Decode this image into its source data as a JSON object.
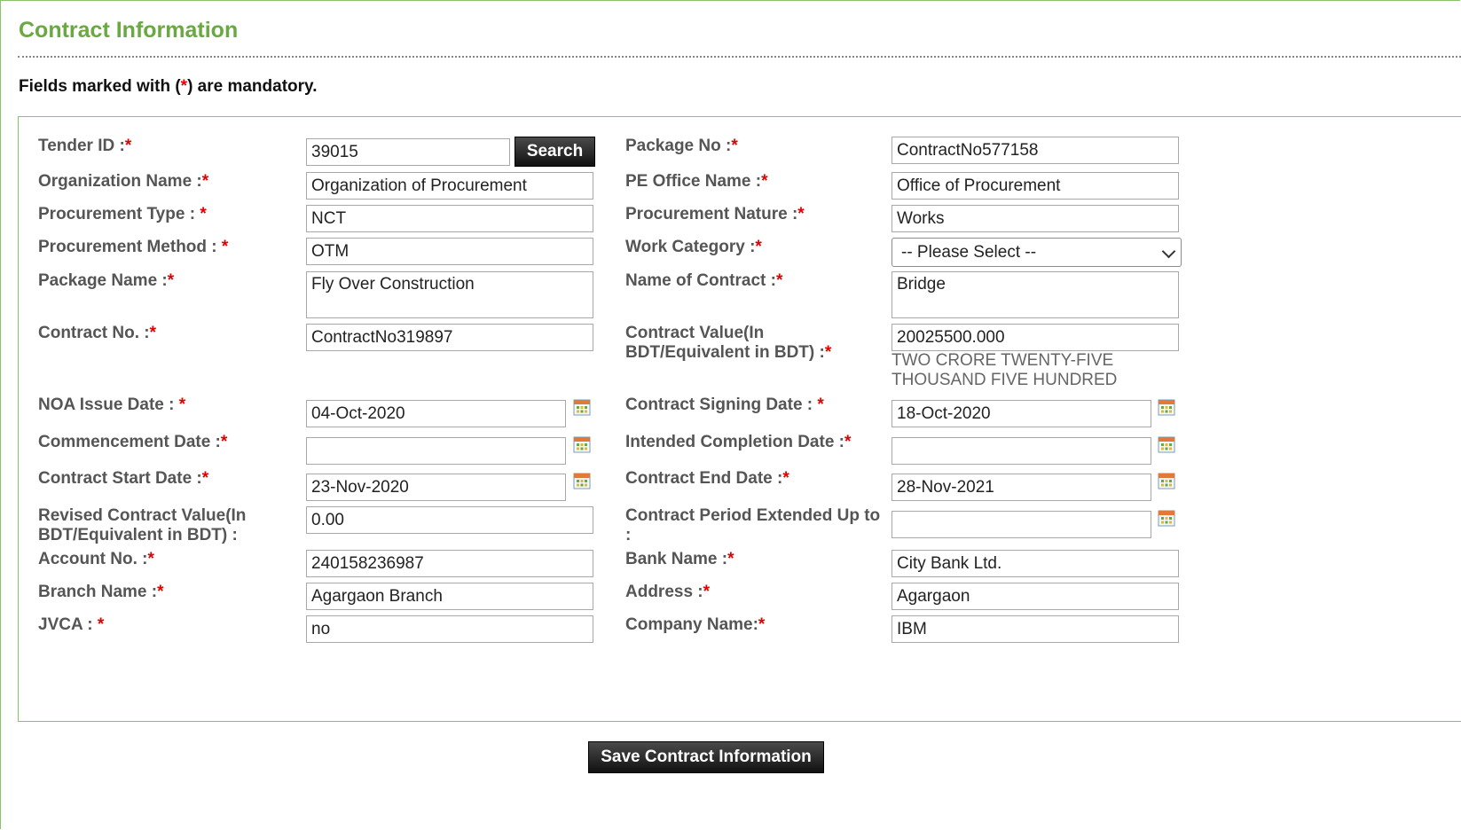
{
  "page": {
    "title": "Contract Information",
    "mandatory_note_prefix": "Fields marked with (",
    "mandatory_note_asterisk": "*",
    "mandatory_note_suffix": ") are mandatory."
  },
  "colors": {
    "accent": "#6aa842",
    "required": "#e00000",
    "label": "#555555"
  },
  "required_mark": "*",
  "form": {
    "tender_id": {
      "label": "Tender ID :",
      "value": "39015"
    },
    "search_button": "Search",
    "package_no": {
      "label": "Package No :",
      "value": "ContractNo577158"
    },
    "organization_name": {
      "label": "Organization Name :",
      "value": "Organization of Procurement"
    },
    "pe_office_name": {
      "label": "PE Office Name :",
      "value": "Office of Procurement"
    },
    "procurement_type": {
      "label": "Procurement Type : ",
      "value": "NCT"
    },
    "procurement_nature": {
      "label": "Procurement Nature :",
      "value": "Works"
    },
    "procurement_method": {
      "label": "Procurement Method : ",
      "value": "OTM"
    },
    "work_category": {
      "label": "Work Category :",
      "selected": "-- Please Select --"
    },
    "package_name": {
      "label": "Package Name :",
      "value": "Fly Over Construction"
    },
    "name_of_contract": {
      "label": "Name of Contract :",
      "value": "Bridge"
    },
    "contract_no": {
      "label": "Contract No. :",
      "value": "ContractNo319897"
    },
    "contract_value": {
      "label_line1": "Contract Value(In",
      "label_line2": "BDT/Equivalent in BDT) :",
      "value": "20025500.000",
      "in_words_line1": "TWO CRORE TWENTY-FIVE",
      "in_words_line2": "THOUSAND FIVE HUNDRED"
    },
    "noa_issue_date": {
      "label": "NOA Issue Date : ",
      "value": "04-Oct-2020"
    },
    "contract_signing_date": {
      "label": "Contract Signing Date : ",
      "value": "18-Oct-2020"
    },
    "commencement_date": {
      "label": "Commencement Date :",
      "value": ""
    },
    "intended_completion_date": {
      "label": "Intended Completion Date :",
      "value": ""
    },
    "contract_start_date": {
      "label": "Contract Start Date :",
      "value": "23-Nov-2020"
    },
    "contract_end_date": {
      "label": "Contract End Date :",
      "value": "28-Nov-2021"
    },
    "revised_contract_value": {
      "label_line1": "Revised Contract Value(In",
      "label_line2": "BDT/Equivalent in BDT) :",
      "value": "0.00"
    },
    "contract_period_extended": {
      "label_line1": "Contract Period Extended Up to",
      "label_line2": ":",
      "value": ""
    },
    "account_no": {
      "label": "Account No. :",
      "value": "240158236987"
    },
    "bank_name": {
      "label": "Bank Name :",
      "value": "City Bank Ltd."
    },
    "branch_name": {
      "label": "Branch Name :",
      "value": "Agargaon Branch"
    },
    "address": {
      "label": "Address :",
      "value": "Agargaon"
    },
    "jvca": {
      "label": "JVCA : ",
      "value": "no"
    },
    "company_name": {
      "label": "Company Name:",
      "value": "IBM"
    }
  },
  "save_button": "Save Contract Information",
  "icons": {
    "calendar": "calendar-icon",
    "dropdown": "chevron-down-icon"
  }
}
